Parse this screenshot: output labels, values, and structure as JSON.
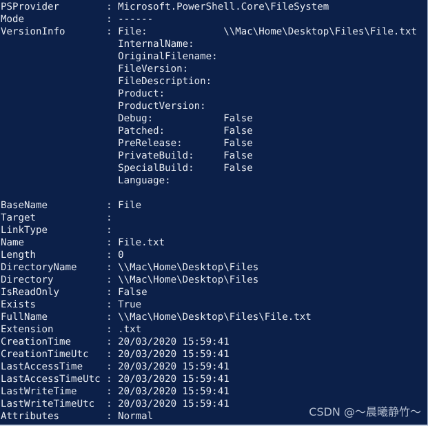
{
  "console": {
    "background_color": "#0c2049",
    "foreground_color": "#e9ecf2",
    "label_column_width": 18,
    "version_info_indent": 20,
    "properties": [
      {
        "label": "PSProvider",
        "value": "Microsoft.PowerShell.Core\\FileSystem"
      },
      {
        "label": "Mode",
        "value": "------"
      },
      {
        "label": "VersionInfo",
        "value": ""
      }
    ],
    "version_info": [
      {
        "label": "File:",
        "value": "\\\\Mac\\Home\\Desktop\\Files\\File.txt"
      },
      {
        "label": "InternalName:",
        "value": ""
      },
      {
        "label": "OriginalFilename:",
        "value": ""
      },
      {
        "label": "FileVersion:",
        "value": ""
      },
      {
        "label": "FileDescription:",
        "value": ""
      },
      {
        "label": "Product:",
        "value": ""
      },
      {
        "label": "ProductVersion:",
        "value": ""
      },
      {
        "label": "Debug:",
        "value": "False"
      },
      {
        "label": "Patched:",
        "value": "False"
      },
      {
        "label": "PreRelease:",
        "value": "False"
      },
      {
        "label": "PrivateBuild:",
        "value": "False"
      },
      {
        "label": "SpecialBuild:",
        "value": "False"
      },
      {
        "label": "Language:",
        "value": ""
      }
    ],
    "file_properties": [
      {
        "label": "BaseName",
        "value": "File"
      },
      {
        "label": "Target",
        "value": ""
      },
      {
        "label": "LinkType",
        "value": ""
      },
      {
        "label": "Name",
        "value": "File.txt"
      },
      {
        "label": "Length",
        "value": "0"
      },
      {
        "label": "DirectoryName",
        "value": "\\\\Mac\\Home\\Desktop\\Files"
      },
      {
        "label": "Directory",
        "value": "\\\\Mac\\Home\\Desktop\\Files"
      },
      {
        "label": "IsReadOnly",
        "value": "False"
      },
      {
        "label": "Exists",
        "value": "True"
      },
      {
        "label": "FullName",
        "value": "\\\\Mac\\Home\\Desktop\\Files\\File.txt"
      },
      {
        "label": "Extension",
        "value": ".txt"
      },
      {
        "label": "CreationTime",
        "value": "20/03/2020 15:59:41"
      },
      {
        "label": "CreationTimeUtc",
        "value": "20/03/2020 15:59:41"
      },
      {
        "label": "LastAccessTime",
        "value": "20/03/2020 15:59:41"
      },
      {
        "label": "LastAccessTimeUtc",
        "value": "20/03/2020 15:59:41"
      },
      {
        "label": "LastWriteTime",
        "value": "20/03/2020 15:59:41"
      },
      {
        "label": "LastWriteTimeUtc",
        "value": "20/03/2020 15:59:41"
      },
      {
        "label": "Attributes",
        "value": "Normal"
      }
    ]
  },
  "watermark": {
    "text": "CSDN @～晨曦静竹～"
  }
}
